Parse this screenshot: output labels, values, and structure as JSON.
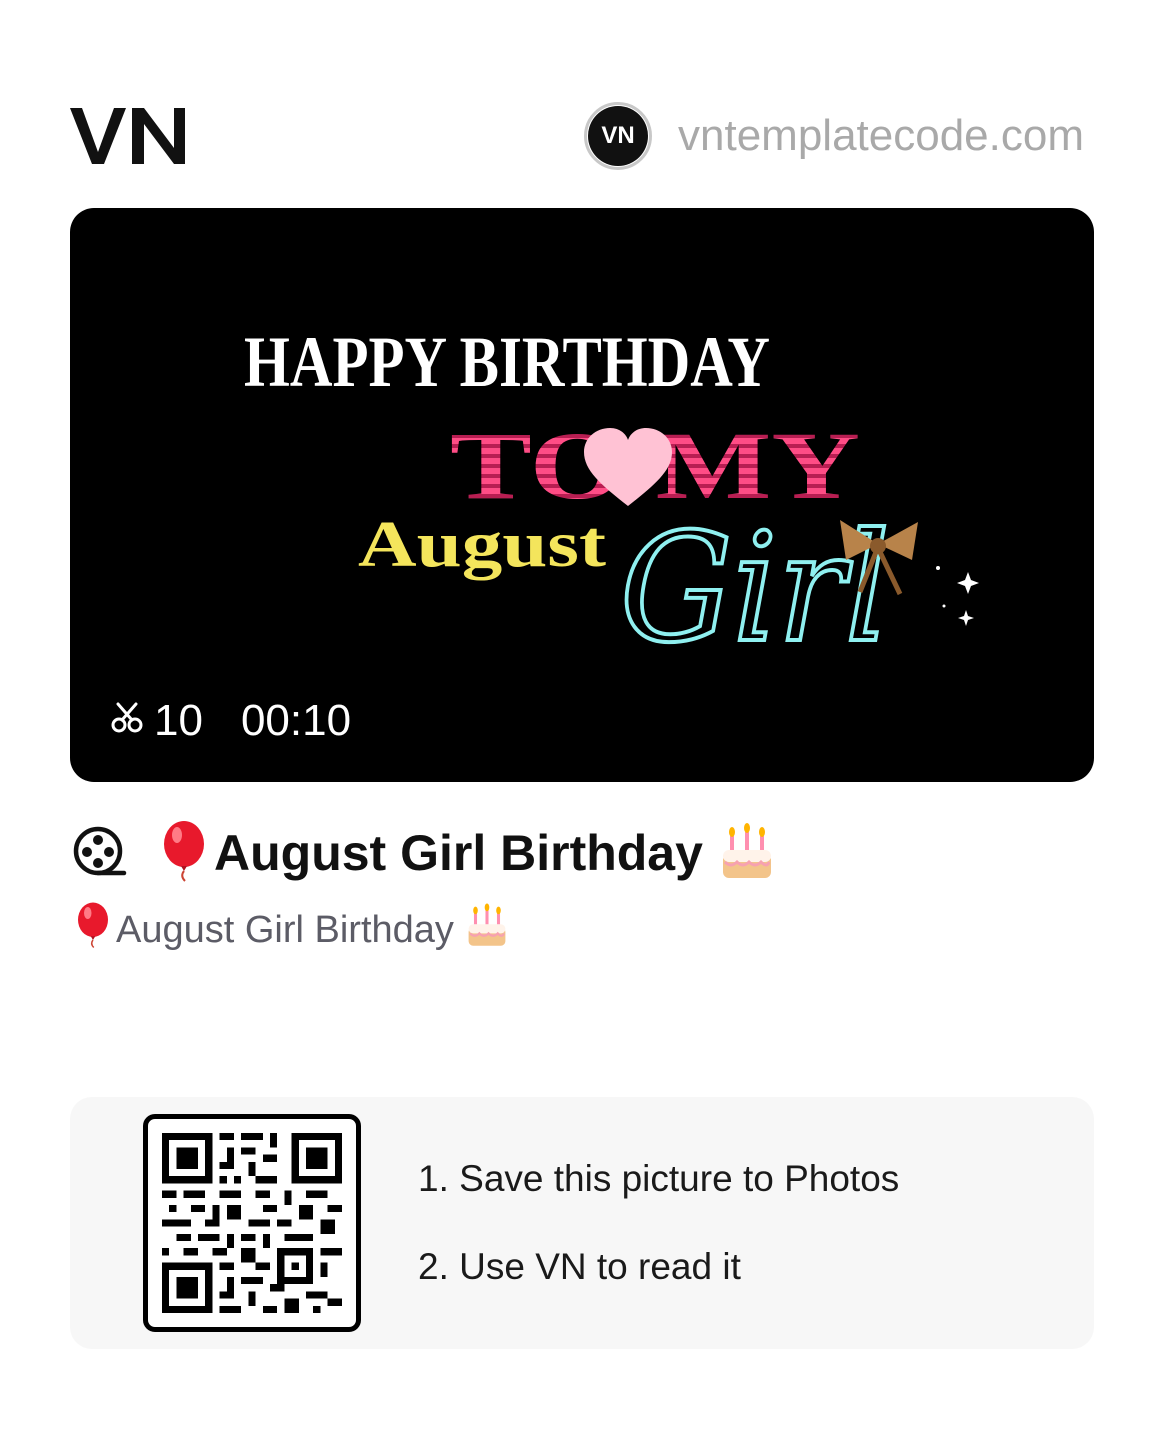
{
  "header": {
    "logo_text": "VN",
    "author": {
      "avatar_text": "VN",
      "name": "vntemplatecode.com"
    }
  },
  "preview": {
    "artwork": {
      "line1": "HAPPY BIRTHDAY",
      "line2": "TO MY",
      "line3": "August",
      "line4": "Girl"
    },
    "clip_icon": "scissors-icon",
    "clip_count": "10",
    "duration": "00:10"
  },
  "template": {
    "type_icon": "film-reel-icon",
    "title_emoji_start": "balloon-emoji",
    "title": "August Girl Birthday",
    "title_emoji_end": "birthday-cake-emoji",
    "subtitle": "August Girl Birthday"
  },
  "qr_card": {
    "qr_icon": "qr-code",
    "steps": [
      "1. Save this picture to Photos",
      "2. Use VN to read it"
    ]
  },
  "colors": {
    "text_primary": "#111111",
    "text_muted": "#a9a9a9",
    "text_secondary": "#5c5c66",
    "preview_bg": "#000000",
    "card_bg": "#f7f7f7",
    "pink": "#ff4d86",
    "yellow": "#f4e55c",
    "cyan": "#8ff0f0"
  }
}
